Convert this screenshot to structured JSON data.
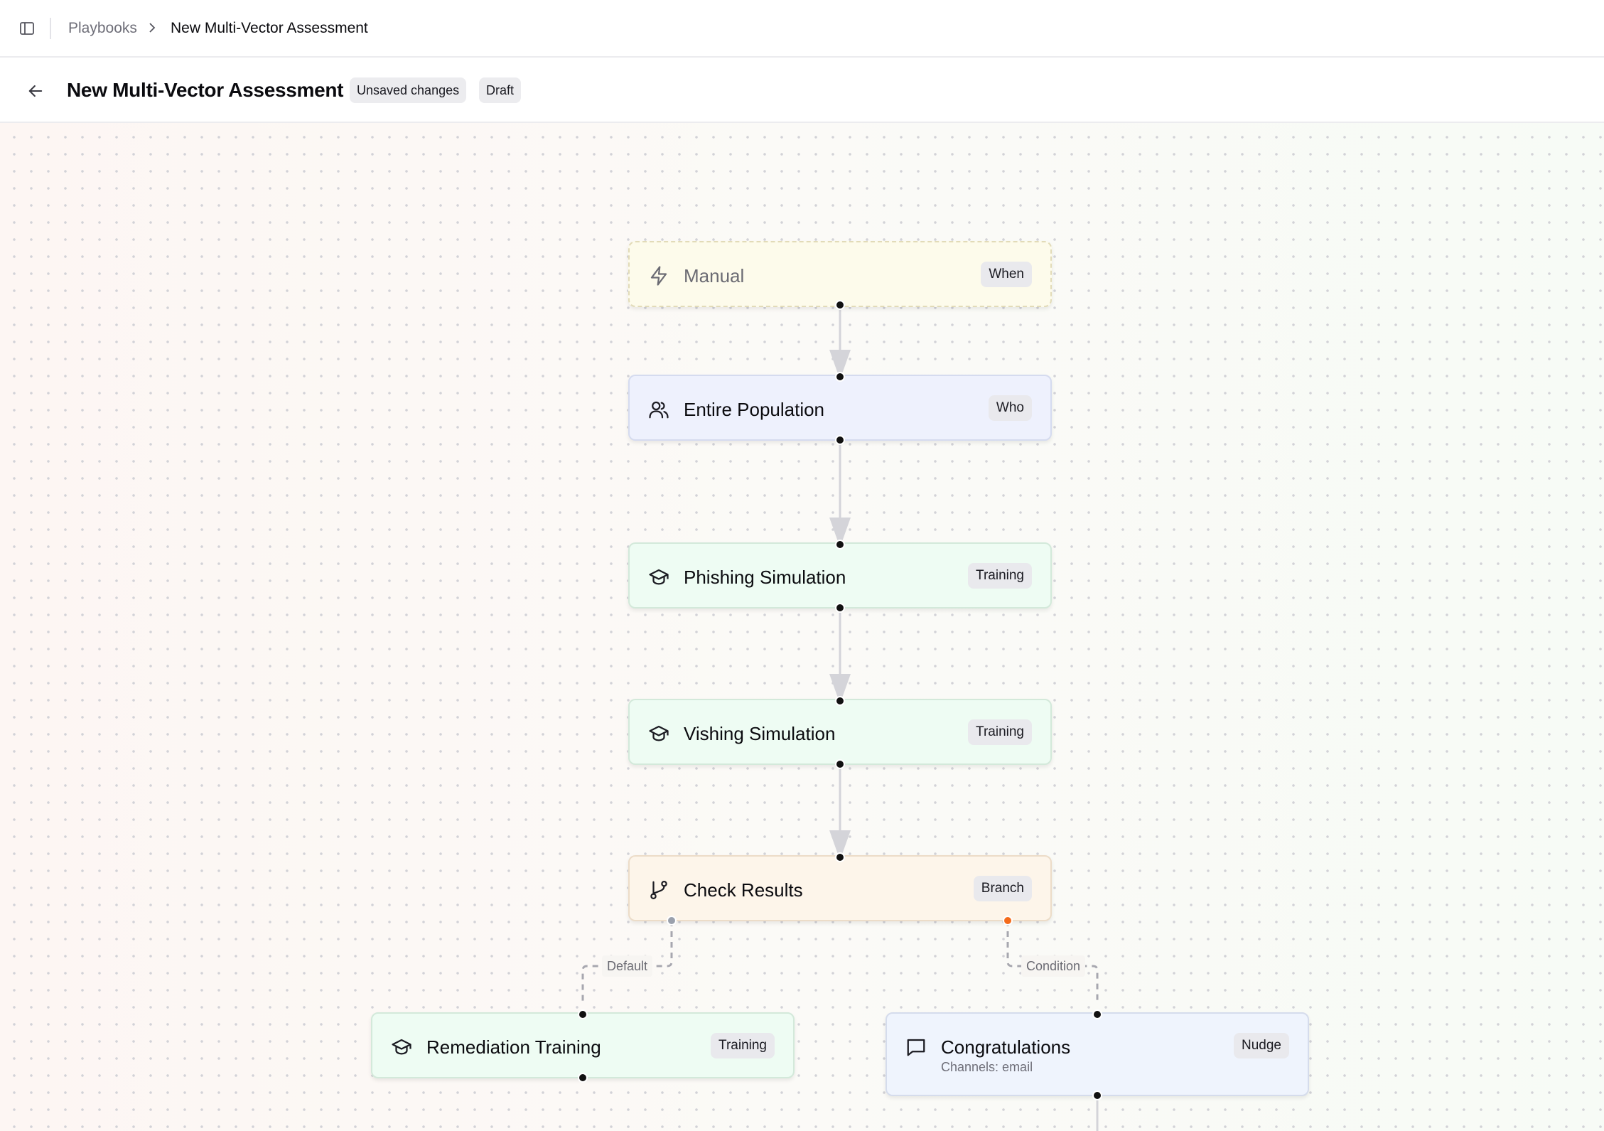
{
  "breadcrumb": {
    "root": "Playbooks",
    "current": "New Multi-Vector Assessment"
  },
  "header": {
    "title": "New Multi-Vector Assessment",
    "badges": [
      "Unsaved changes",
      "Draft"
    ]
  },
  "nodes": {
    "manual": {
      "label": "Manual",
      "tag": "When",
      "icon": "lightning-icon"
    },
    "population": {
      "label": "Entire Population",
      "tag": "Who",
      "icon": "users-icon"
    },
    "phishing": {
      "label": "Phishing Simulation",
      "tag": "Training",
      "icon": "graduation-cap-icon"
    },
    "vishing": {
      "label": "Vishing Simulation",
      "tag": "Training",
      "icon": "graduation-cap-icon"
    },
    "check": {
      "label": "Check Results",
      "tag": "Branch",
      "icon": "git-branch-icon"
    },
    "remediation": {
      "label": "Remediation Training",
      "tag": "Training",
      "icon": "graduation-cap-icon"
    },
    "congrats": {
      "label": "Congratulations",
      "tag": "Nudge",
      "sub": "Channels: email",
      "icon": "message-square-icon"
    }
  },
  "edges": {
    "default_label": "Default",
    "condition_label": "Condition"
  },
  "colors": {
    "accent_branch": "#f46b1b",
    "manual_bg": "#fdfbeb",
    "who_bg": "#eef1fd",
    "training_bg": "#eefcf3",
    "branch_bg": "#fdf5ea",
    "nudge_bg": "#eff4fd"
  }
}
